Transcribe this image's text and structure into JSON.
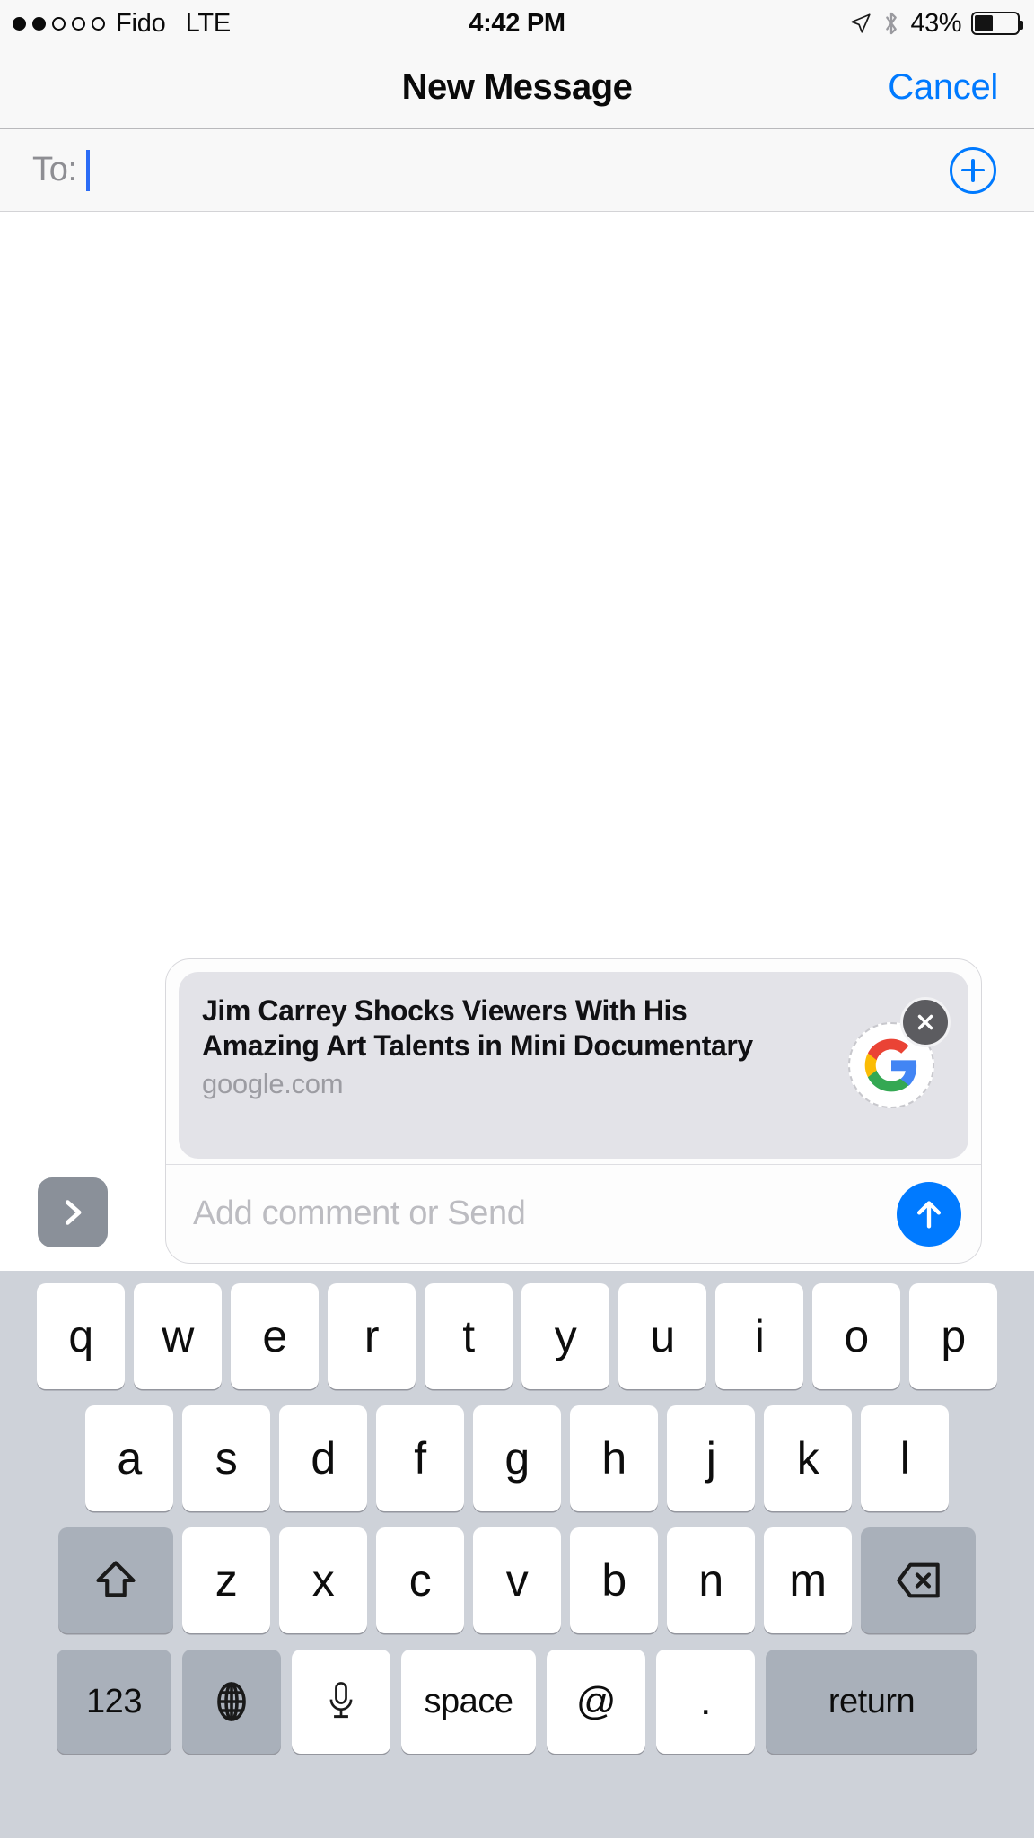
{
  "status_bar": {
    "carrier": "Fido",
    "network": "LTE",
    "time": "4:42 PM",
    "battery_percent": "43%",
    "battery_level": 43,
    "signal_bars_filled": 2,
    "signal_bars_total": 5,
    "icons": [
      "location-arrow-icon",
      "bluetooth-icon",
      "battery-icon"
    ]
  },
  "nav": {
    "title": "New Message",
    "cancel_label": "Cancel",
    "accent_color": "#007aff"
  },
  "to_field": {
    "label": "To:",
    "value": "",
    "add_contact_icon": "plus-circle-icon"
  },
  "link_preview": {
    "title": "Jim Carrey Shocks Viewers With His Amazing Art Talents in Mini Documentary",
    "domain": "google.com",
    "logo": "google-g-icon",
    "close_icon": "close-circle-icon",
    "comment_placeholder": "Add comment or Send",
    "comment_value": "",
    "send_icon": "arrow-up-icon",
    "expand_icon": "chevron-right-icon",
    "send_button_color": "#007aff",
    "card_background": "#e3e3e8"
  },
  "keyboard": {
    "row1": [
      "q",
      "w",
      "e",
      "r",
      "t",
      "y",
      "u",
      "i",
      "o",
      "p"
    ],
    "row2": [
      "a",
      "s",
      "d",
      "f",
      "g",
      "h",
      "j",
      "k",
      "l"
    ],
    "row3": [
      "z",
      "x",
      "c",
      "v",
      "b",
      "n",
      "m"
    ],
    "shift_icon": "shift-arrow-icon",
    "backspace_icon": "backspace-icon",
    "numeric_label": "123",
    "globe_icon": "globe-icon",
    "mic_icon": "microphone-icon",
    "space_label": "space",
    "at_label": "@",
    "period_label": ".",
    "return_label": "return"
  }
}
